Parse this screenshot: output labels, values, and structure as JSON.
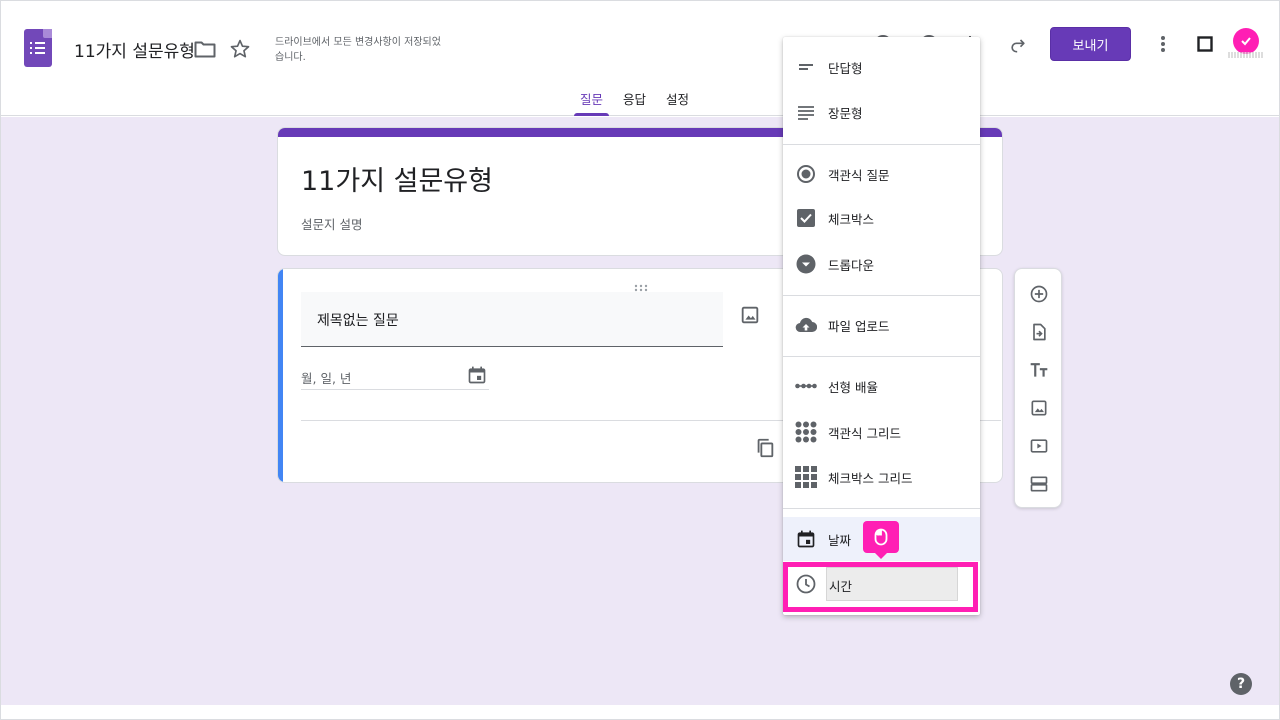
{
  "header": {
    "doc_title": "11가지 설문유형",
    "save_status": "드라이브에서 모든 변경사항이 저장되었습니다.",
    "send_label": "보내기"
  },
  "tabs": [
    {
      "label": "질문",
      "active": true
    },
    {
      "label": "응답",
      "active": false
    },
    {
      "label": "설정",
      "active": false
    }
  ],
  "form": {
    "title": "11가지 설문유형",
    "description": "설문지 설명"
  },
  "question": {
    "title": "제목없는 질문",
    "date_placeholder": "월, 일, 년"
  },
  "menu": {
    "items": [
      {
        "label": "단답형",
        "icon": "short-answer-icon"
      },
      {
        "label": "장문형",
        "icon": "paragraph-icon"
      },
      {
        "label": "객관식 질문",
        "icon": "radio-icon"
      },
      {
        "label": "체크박스",
        "icon": "checkbox-icon"
      },
      {
        "label": "드롭다운",
        "icon": "dropdown-icon"
      },
      {
        "label": "파일 업로드",
        "icon": "cloud-upload-icon"
      },
      {
        "label": "선형 배율",
        "icon": "linear-scale-icon"
      },
      {
        "label": "객관식 그리드",
        "icon": "grid-dots-icon"
      },
      {
        "label": "체크박스 그리드",
        "icon": "grid-squares-icon"
      },
      {
        "label": "날짜",
        "icon": "calendar-icon"
      },
      {
        "label": "시간",
        "icon": "clock-icon"
      }
    ]
  },
  "colors": {
    "brand": "#673ab7",
    "canvas": "#ede7f6",
    "highlight": "#ff1fb4",
    "question_accent": "#4285f4"
  }
}
